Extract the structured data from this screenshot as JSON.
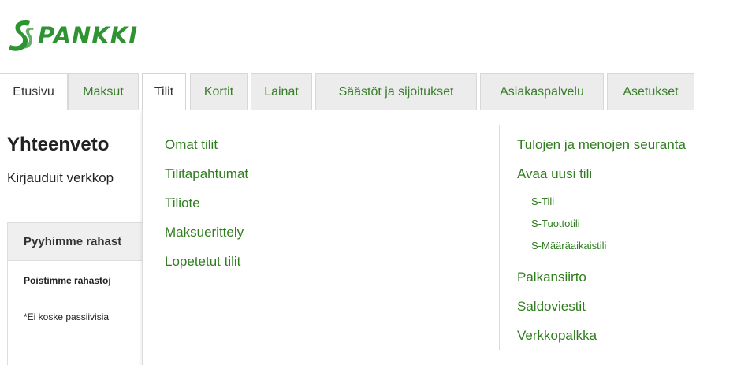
{
  "brand": {
    "name": "PANKKI",
    "color": "#2d9431"
  },
  "tabs": [
    {
      "label": "Etusivu"
    },
    {
      "label": "Maksut"
    },
    {
      "label": "Tilit"
    },
    {
      "label": "Kortit"
    },
    {
      "label": "Lainat"
    },
    {
      "label": "Säästöt ja sijoitukset"
    },
    {
      "label": "Asiakaspalvelu"
    },
    {
      "label": "Asetukset"
    }
  ],
  "active_tab": "Tilit",
  "page": {
    "title": "Yhteenveto",
    "subtitle": "Kirjauduit verkkop"
  },
  "notice": {
    "heading": "Pyyhimme rahast",
    "line1": "Poistimme rahastoj",
    "line2": "*Ei koske passiivisia"
  },
  "dropdown": {
    "left_links": [
      "Omat tilit",
      "Tilitapahtumat",
      "Tiliote",
      "Maksuerittely",
      "Lopetetut tilit"
    ],
    "right_top": [
      "Tulojen ja menojen seuranta",
      "Avaa uusi tili"
    ],
    "new_account_types": [
      "S-Tili",
      "S-Tuottotili",
      "S-Määräaikaistili"
    ],
    "right_bottom": [
      "Palkansiirto",
      "Saldoviestit",
      "Verkkopalkka"
    ]
  },
  "colors": {
    "link": "#2f7d1f",
    "tab_bg": "#ececec",
    "panel_header_bg": "#efefef"
  }
}
